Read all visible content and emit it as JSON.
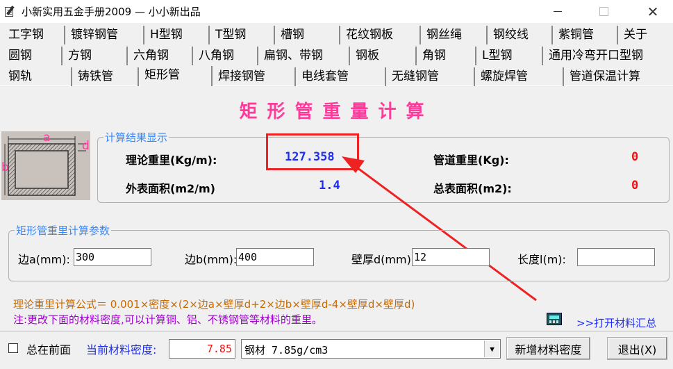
{
  "window": {
    "title": "小新实用五金手册2009 — 小小新出品",
    "close_glyph": "✕"
  },
  "tabs": {
    "row1": [
      "工字钢",
      "镀锌钢管",
      "H型钢",
      "T型钢",
      "槽钢",
      "花纹钢板",
      "钢丝绳",
      "钢绞线",
      "紫铜管",
      "关于"
    ],
    "row2": [
      "圆钢",
      "方钢",
      "六角钢",
      "八角钢",
      "扁钢、带钢",
      "钢板",
      "角钢",
      "L型钢",
      "通用冷弯开口型钢"
    ],
    "row3": [
      "钢轨",
      "铸铁管",
      "矩形管",
      "焊接钢管",
      "电线套管",
      "无缝钢管",
      "螺旋焊管",
      "管道保温计算"
    ],
    "active": "矩形管"
  },
  "heading": "矩形管重量计算",
  "diagram": {
    "label_a": "a",
    "label_b": "b",
    "label_d": "d"
  },
  "results": {
    "legend": "计算结果显示",
    "theory_weight_label": "理论重里(Kg/m):",
    "theory_weight_value": "127.358",
    "surface_area_label": "外表面积(m2/m)",
    "surface_area_value": "1.4",
    "pipe_weight_label": "管道重里(Kg):",
    "pipe_weight_value": "0",
    "total_area_label": "总表面积(m2):",
    "total_area_value": "0"
  },
  "params": {
    "legend": "矩形管重里计算参数",
    "side_a_label": "边a(mm):",
    "side_a_value": "300",
    "side_b_label": "边b(mm):",
    "side_b_value": "400",
    "thickness_label": "壁厚d(mm)",
    "thickness_value": "12",
    "length_label": "长度l(m):",
    "length_value": ""
  },
  "formula": "理论重里计算公式＝ 0.001×密度×(2×边a×壁厚d+2×边b×壁厚d-4×壁厚d×壁厚d)",
  "note": "注:更改下面的材料密度,可以计算铜、铝、不锈钢管等材料的重里。",
  "open_summary_link": ">>打开材料汇总",
  "bottom": {
    "always_on_top_label": "总在前面",
    "always_on_top_checked": false,
    "density_label": "当前材料密度:",
    "density_value": "7.85",
    "material_selected": "钢材 7.85g/cm3",
    "add_density_button": "新增材料密度",
    "exit_button": "退出(X)"
  },
  "colors": {
    "heading": "#ff3a9a",
    "value_blue": "#1f2ef0",
    "value_red": "#ee1111",
    "legend_blue": "#3388ff",
    "formula_orange": "#c96a00",
    "note_purple": "#a000d0",
    "annotation_red": "#ee2222"
  }
}
